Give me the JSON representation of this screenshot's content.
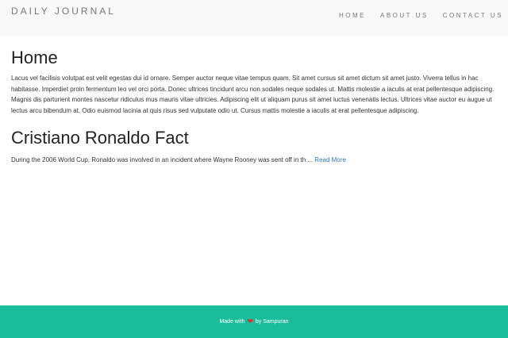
{
  "navbar": {
    "brand": "DAILY JOURNAL",
    "links": [
      "HOME",
      "ABOUT US",
      "CONTACT US"
    ]
  },
  "home": {
    "title": "Home",
    "body": "Lacus vel facilisis volutpat est velit egestas dui id ornare. Semper auctor neque vitae tempus quam. Sit amet cursus sit amet dictum sit amet justo. Viverra tellus in hac habitasse. Imperdiet proin fermentum leo vel orci porta. Donec ultrices tincidunt arcu non sodales neque sodales ut. Mattis molestie a iaculis at erat pellentesque adipiscing. Magnis dis parturient montes nascetur ridiculus mus mauris vitae ultricies. Adipiscing elit ut aliquam purus sit amet luctus venenatis lectus. Ultrices vitae auctor eu augue ut lectus arcu bibendum at. Odio euismod lacinia at quis risus sed vulputate odio ut. Cursus mattis molestie a iaculis at erat pellentesque adipiscing."
  },
  "post": {
    "title": "Cristiano Ronaldo Fact",
    "excerpt": "During the 2006 World Cup, Ronaldo was involved in an incident where Wayne Rooney was sent off in th ... ",
    "read_more": "Read More"
  },
  "footer": {
    "prefix": "Made with",
    "heart_icon": "heart-icon",
    "heart_color": "#e62e2e",
    "suffix": "by Sampuran"
  },
  "colors": {
    "navbar_bg": "#f8f8f8",
    "footer_bg": "#1abc9c",
    "link": "#337ab7"
  }
}
